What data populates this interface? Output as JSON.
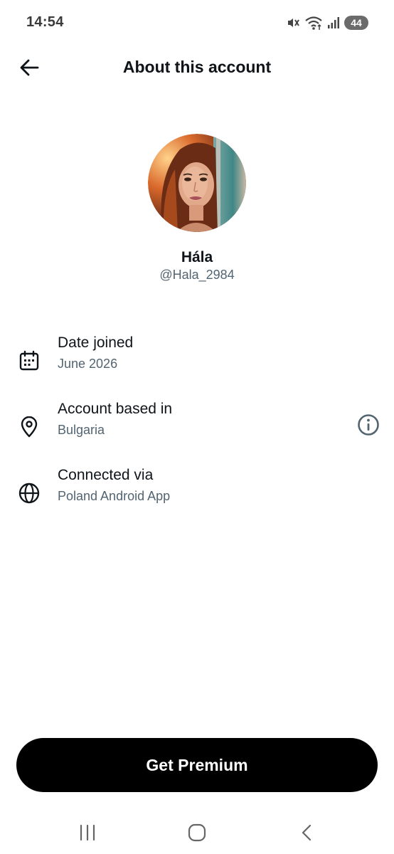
{
  "status_bar": {
    "time": "14:54",
    "battery": "44",
    "icons": [
      "mute-icon",
      "wifi-icon",
      "signal-icon",
      "battery-icon"
    ]
  },
  "header": {
    "back_icon": "arrow-left-icon",
    "title": "About this account"
  },
  "profile": {
    "display_name": "Hála",
    "handle": "@Hala_2984",
    "avatar_icon": "profile-photo"
  },
  "info_rows": [
    {
      "icon": "calendar-icon",
      "label": "Date joined",
      "value": "June 2026"
    },
    {
      "icon": "location-pin-icon",
      "label": "Account based in",
      "value": "Bulgaria",
      "action_icon": "info-icon"
    },
    {
      "icon": "globe-icon",
      "label": "Connected via",
      "value": "Poland Android App"
    }
  ],
  "premium_button": {
    "label": "Get Premium"
  },
  "nav_bar": {
    "items": [
      "recent-apps-icon",
      "home-icon",
      "back-icon"
    ]
  },
  "colors": {
    "primary_text": "#0f1419",
    "secondary_text": "#536471",
    "button_bg": "#000000",
    "button_text": "#ffffff"
  }
}
